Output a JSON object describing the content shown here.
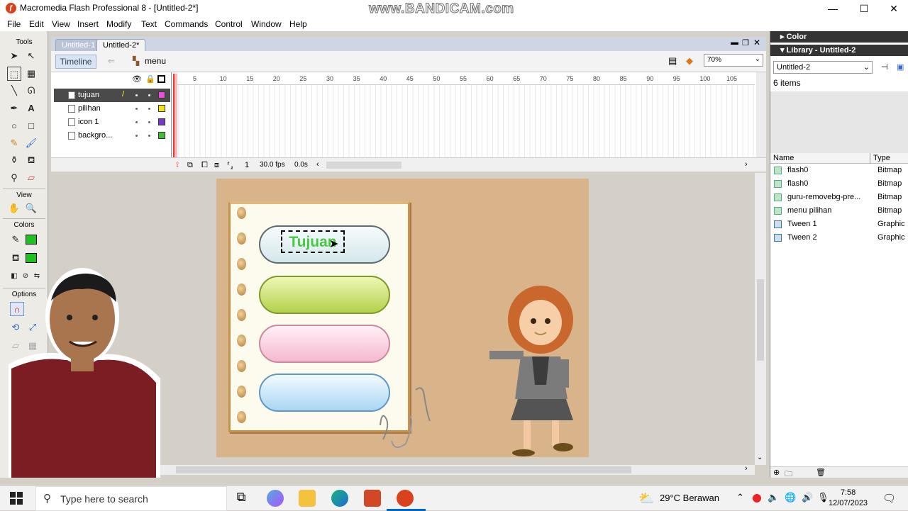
{
  "window": {
    "title": "Macromedia Flash Professional 8 - [Untitled-2*]",
    "watermark": "www.BANDICAM.com",
    "minimize": "—",
    "maximize": "☐",
    "close": "✕"
  },
  "menu": [
    "File",
    "Edit",
    "View",
    "Insert",
    "Modify",
    "Text",
    "Commands",
    "Control",
    "Window",
    "Help"
  ],
  "tools": {
    "header": "Tools",
    "view_label": "View",
    "colors_label": "Colors",
    "options_label": "Options"
  },
  "doc_tabs": [
    "Untitled-1",
    "Untitled-2*"
  ],
  "edit_bar": {
    "timeline_button": "Timeline",
    "scene": "menu",
    "zoom": "70%"
  },
  "timeline": {
    "layers": [
      {
        "name": "tujuan",
        "color": "#e84fe0",
        "selected": true
      },
      {
        "name": "pilihan",
        "color": "#f5e21a",
        "selected": false
      },
      {
        "name": "icon 1",
        "color": "#7a36c8",
        "selected": false
      },
      {
        "name": "backgro...",
        "color": "#3fbf32",
        "selected": false
      }
    ],
    "ruler": [
      "5",
      "10",
      "15",
      "20",
      "25",
      "30",
      "35",
      "40",
      "45",
      "50",
      "55",
      "60",
      "65",
      "70",
      "75",
      "80",
      "85",
      "90",
      "95",
      "100",
      "105"
    ],
    "current_frame": "1",
    "fps": "30.0 fps",
    "time": "0.0s"
  },
  "stage": {
    "selected_text": "Tujuan"
  },
  "panel": {
    "color_title": "Color",
    "library_title": "Library - Untitled-2",
    "library_select": "Untitled-2",
    "items_count": "6 items",
    "col_name": "Name",
    "col_type": "Type",
    "items": [
      {
        "name": "flash0",
        "type": "Bitmap"
      },
      {
        "name": "flash0",
        "type": "Bitmap"
      },
      {
        "name": "guru-removebg-pre...",
        "type": "Bitmap"
      },
      {
        "name": "menu pilihan",
        "type": "Bitmap"
      },
      {
        "name": "Tween 1",
        "type": "Graphic"
      },
      {
        "name": "Tween 2",
        "type": "Graphic"
      }
    ]
  },
  "taskbar": {
    "search_placeholder": "Type here to search",
    "weather": "29°C  Berawan",
    "time": "7:58",
    "date": "12/07/2023"
  }
}
